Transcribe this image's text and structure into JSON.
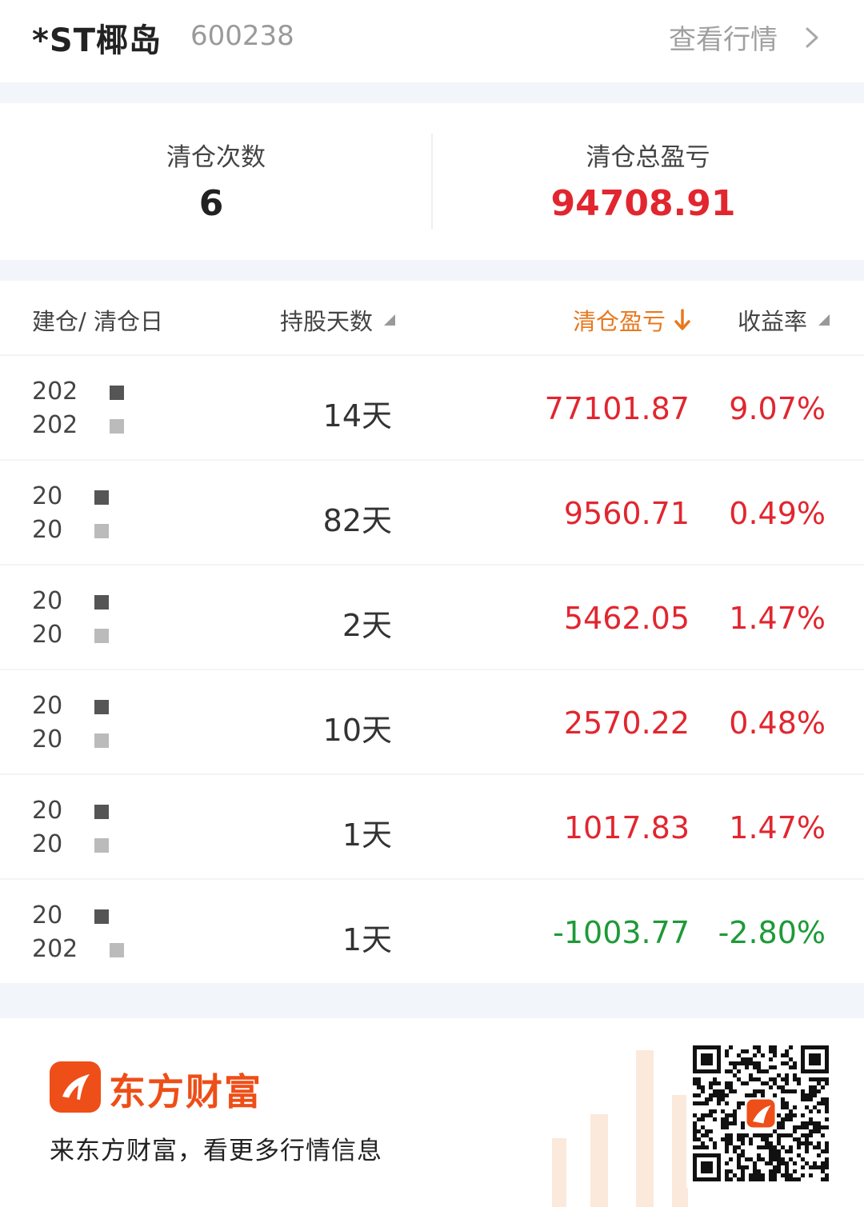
{
  "header": {
    "stock_name": "*ST椰岛",
    "stock_code": "600238",
    "view_link": "查看行情"
  },
  "summary": {
    "count_label": "清仓次数",
    "count_value": "6",
    "total_label": "清仓总盈亏",
    "total_value": "94708.91"
  },
  "table": {
    "headers": {
      "date": "建仓/ 清仓日",
      "days": "持股天数",
      "profit": "清仓盈亏",
      "rate": "收益率"
    },
    "rows": [
      {
        "date1": "202",
        "date2": "202",
        "days": "14天",
        "profit": "77101.87",
        "rate": "9.07%",
        "sign": "pos"
      },
      {
        "date1": "20",
        "date2": "20",
        "days": "82天",
        "profit": "9560.71",
        "rate": "0.49%",
        "sign": "pos"
      },
      {
        "date1": "20",
        "date2": "20",
        "days": "2天",
        "profit": "5462.05",
        "rate": "1.47%",
        "sign": "pos"
      },
      {
        "date1": "20",
        "date2": "20",
        "days": "10天",
        "profit": "2570.22",
        "rate": "0.48%",
        "sign": "pos"
      },
      {
        "date1": "20",
        "date2": "20",
        "days": "1天",
        "profit": "1017.83",
        "rate": "1.47%",
        "sign": "pos"
      },
      {
        "date1": "20",
        "date2": "202",
        "days": "1天",
        "profit": "-1003.77",
        "rate": "-2.80%",
        "sign": "neg"
      }
    ]
  },
  "footer": {
    "brand": "东方财富",
    "slogan": "来东方财富，看更多行情信息"
  },
  "icons": {
    "view_link": "chevron-right-icon",
    "sort": "sort-triangle-icon",
    "active_sort": "arrow-down-icon",
    "brand": "eastmoney-logo-icon",
    "qr": "qr-code-icon"
  },
  "colors": {
    "positive": "#e1262f",
    "negative": "#1e9a37",
    "active_header": "#e8791e",
    "brand": "#ee4e17",
    "background_gap": "#f2f5fa"
  }
}
